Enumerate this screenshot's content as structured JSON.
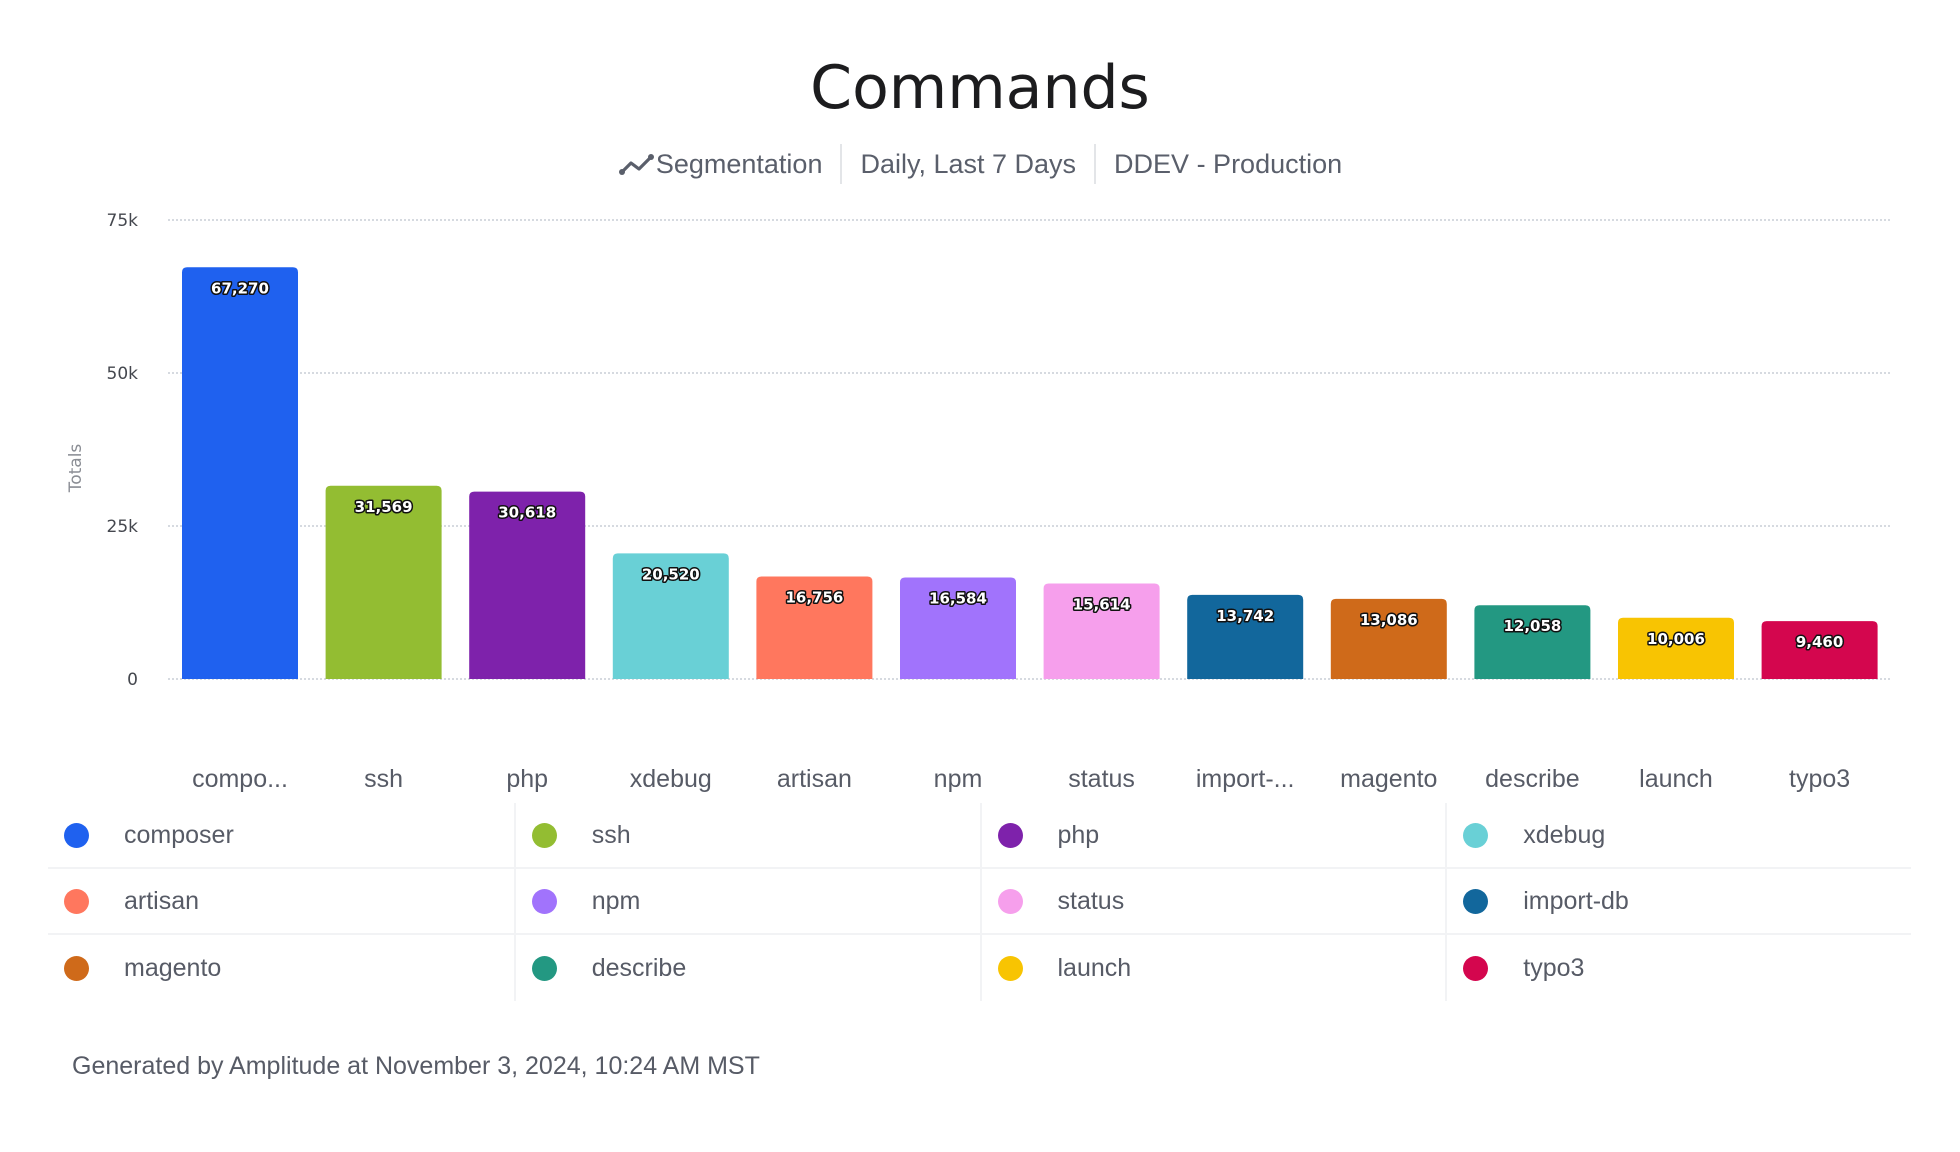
{
  "title": "Commands",
  "subtitle": {
    "icon": "segmentation-line-icon",
    "type": "Segmentation",
    "interval": "Daily, Last 7 Days",
    "project": "DDEV - Production"
  },
  "footer": "Generated by Amplitude at November 3, 2024, 10:24 AM MST",
  "chart_data": {
    "type": "bar",
    "title": "Commands",
    "xlabel": "",
    "ylabel": "Totals",
    "ylim": [
      0,
      75000
    ],
    "yticks": [
      0,
      25000,
      50000,
      75000
    ],
    "ytick_labels": [
      "0",
      "25k",
      "50k",
      "75k"
    ],
    "grid": true,
    "legend_position": "bottom",
    "categories": [
      "composer",
      "ssh",
      "php",
      "xdebug",
      "artisan",
      "npm",
      "status",
      "import-db",
      "magento",
      "describe",
      "launch",
      "typo3"
    ],
    "category_tick_labels": [
      "compo...",
      "ssh",
      "php",
      "xdebug",
      "artisan",
      "npm",
      "status",
      "import-...",
      "magento",
      "describe",
      "launch",
      "typo3"
    ],
    "values": [
      67270,
      31569,
      30618,
      20520,
      16756,
      16584,
      15614,
      13742,
      13086,
      12058,
      10006,
      9460
    ],
    "value_labels": [
      "67,270",
      "31,569",
      "30,618",
      "20,520",
      "16,756",
      "16,584",
      "15,614",
      "13,742",
      "13,086",
      "12,058",
      "10,006",
      "9,460"
    ],
    "colors": [
      "#1f61ef",
      "#93bd32",
      "#7e22ab",
      "#69d0d6",
      "#ff775e",
      "#a173fc",
      "#f69fec",
      "#12679c",
      "#cf6a1a",
      "#239882",
      "#f8c402",
      "#d4064e"
    ]
  },
  "legend": [
    {
      "label": "composer",
      "color": "#1f61ef"
    },
    {
      "label": "ssh",
      "color": "#93bd32"
    },
    {
      "label": "php",
      "color": "#7e22ab"
    },
    {
      "label": "xdebug",
      "color": "#69d0d6"
    },
    {
      "label": "artisan",
      "color": "#ff775e"
    },
    {
      "label": "npm",
      "color": "#a173fc"
    },
    {
      "label": "status",
      "color": "#f69fec"
    },
    {
      "label": "import-db",
      "color": "#12679c"
    },
    {
      "label": "magento",
      "color": "#cf6a1a"
    },
    {
      "label": "describe",
      "color": "#239882"
    },
    {
      "label": "launch",
      "color": "#f8c402"
    },
    {
      "label": "typo3",
      "color": "#d4064e"
    }
  ]
}
